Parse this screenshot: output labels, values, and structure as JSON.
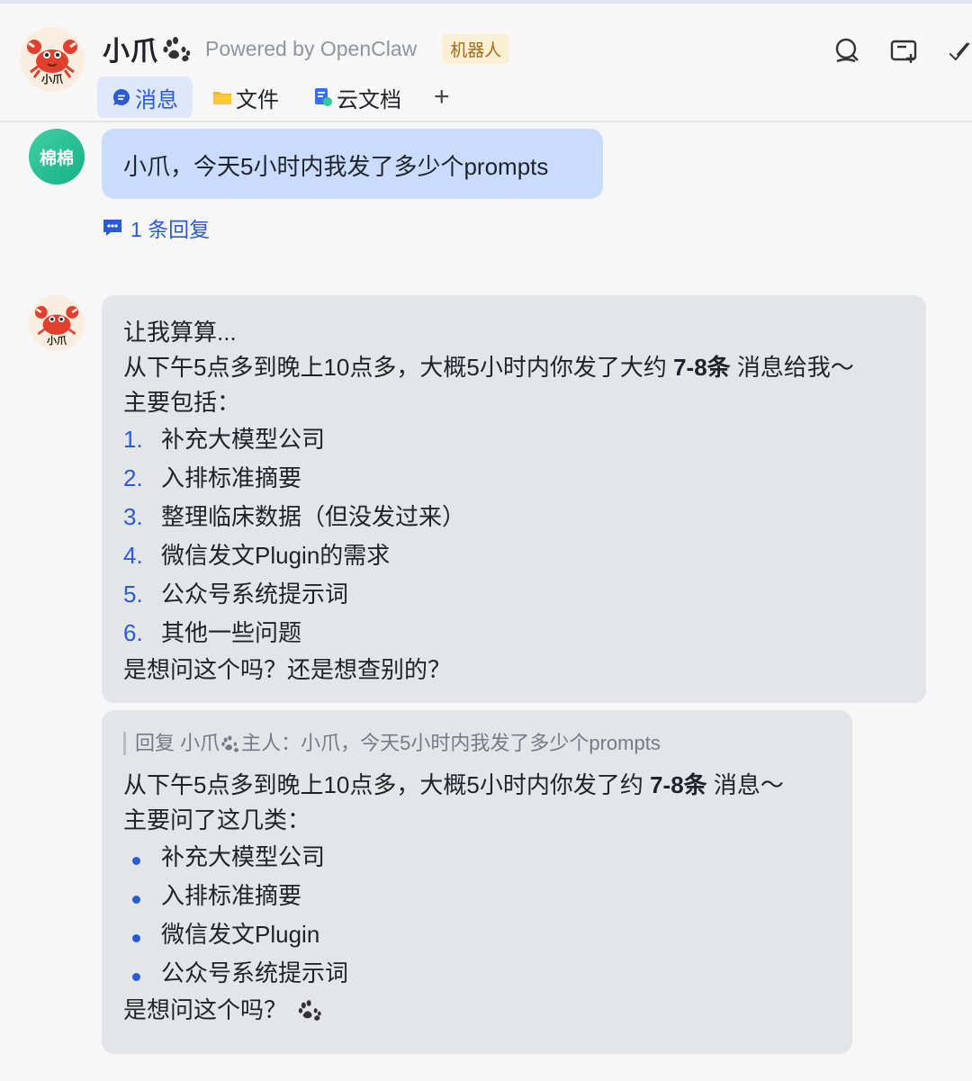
{
  "app": {
    "title": "小爪",
    "subtitle": "Powered by OpenClaw",
    "tag": "机器人",
    "avatar_text": "小爪"
  },
  "tabs": [
    {
      "label": "消息",
      "icon": "chat-bubble-icon",
      "active": true
    },
    {
      "label": "文件",
      "icon": "folder-icon",
      "active": false
    },
    {
      "label": "云文档",
      "icon": "doc-icon",
      "active": false
    },
    {
      "label": "+",
      "icon": "plus-icon",
      "active": false
    }
  ],
  "header_icons": [
    "search-icon",
    "new-chat-icon",
    "checkmark-icon"
  ],
  "user_message": {
    "avatar_text": "棉棉",
    "text": "小爪，今天5小时内我发了多少个prompts",
    "reply_count_label": "1 条回复"
  },
  "bot_message": {
    "avatar_text": "小爪",
    "line1": "让我算算...",
    "line2_pre": "从下午5点多到晚上10点多，大概5小时内你发了大约 ",
    "line2_bold": "7-8条",
    "line2_post": " 消息给我～",
    "line3": "主要包括：",
    "items": [
      {
        "num": "1.",
        "text": "补充大模型公司"
      },
      {
        "num": "2.",
        "text": "入排标准摘要"
      },
      {
        "num": "3.",
        "text": "整理临床数据（但没发过来）"
      },
      {
        "num": "4.",
        "text": "微信发文Plugin的需求"
      },
      {
        "num": "5.",
        "text": "公众号系统提示词"
      },
      {
        "num": "6.",
        "text": "其他一些问题"
      }
    ],
    "closing": "是想问这个吗？还是想查别的？"
  },
  "reply_message": {
    "quote_pre": "回复 小爪",
    "quote_post": "主人：小爪，今天5小时内我发了多少个prompts",
    "line1_pre": "从下午5点多到晚上10点多，大概5小时内你发了约 ",
    "line1_bold": "7-8条",
    "line1_post": " 消息～",
    "line2": "主要问了这几类：",
    "bullets": [
      "补充大模型公司",
      "入排标准摘要",
      "微信发文Plugin",
      "公众号系统提示词"
    ],
    "closing": "是想问这个吗？"
  },
  "colors": {
    "accent": "#2a5bd7",
    "user_bubble": "#cadcfe",
    "bot_bubble": "#e4e5e8",
    "tag_bg": "#fbefd5",
    "tag_fg": "#a86a11",
    "user_avatar": "#16b086"
  }
}
